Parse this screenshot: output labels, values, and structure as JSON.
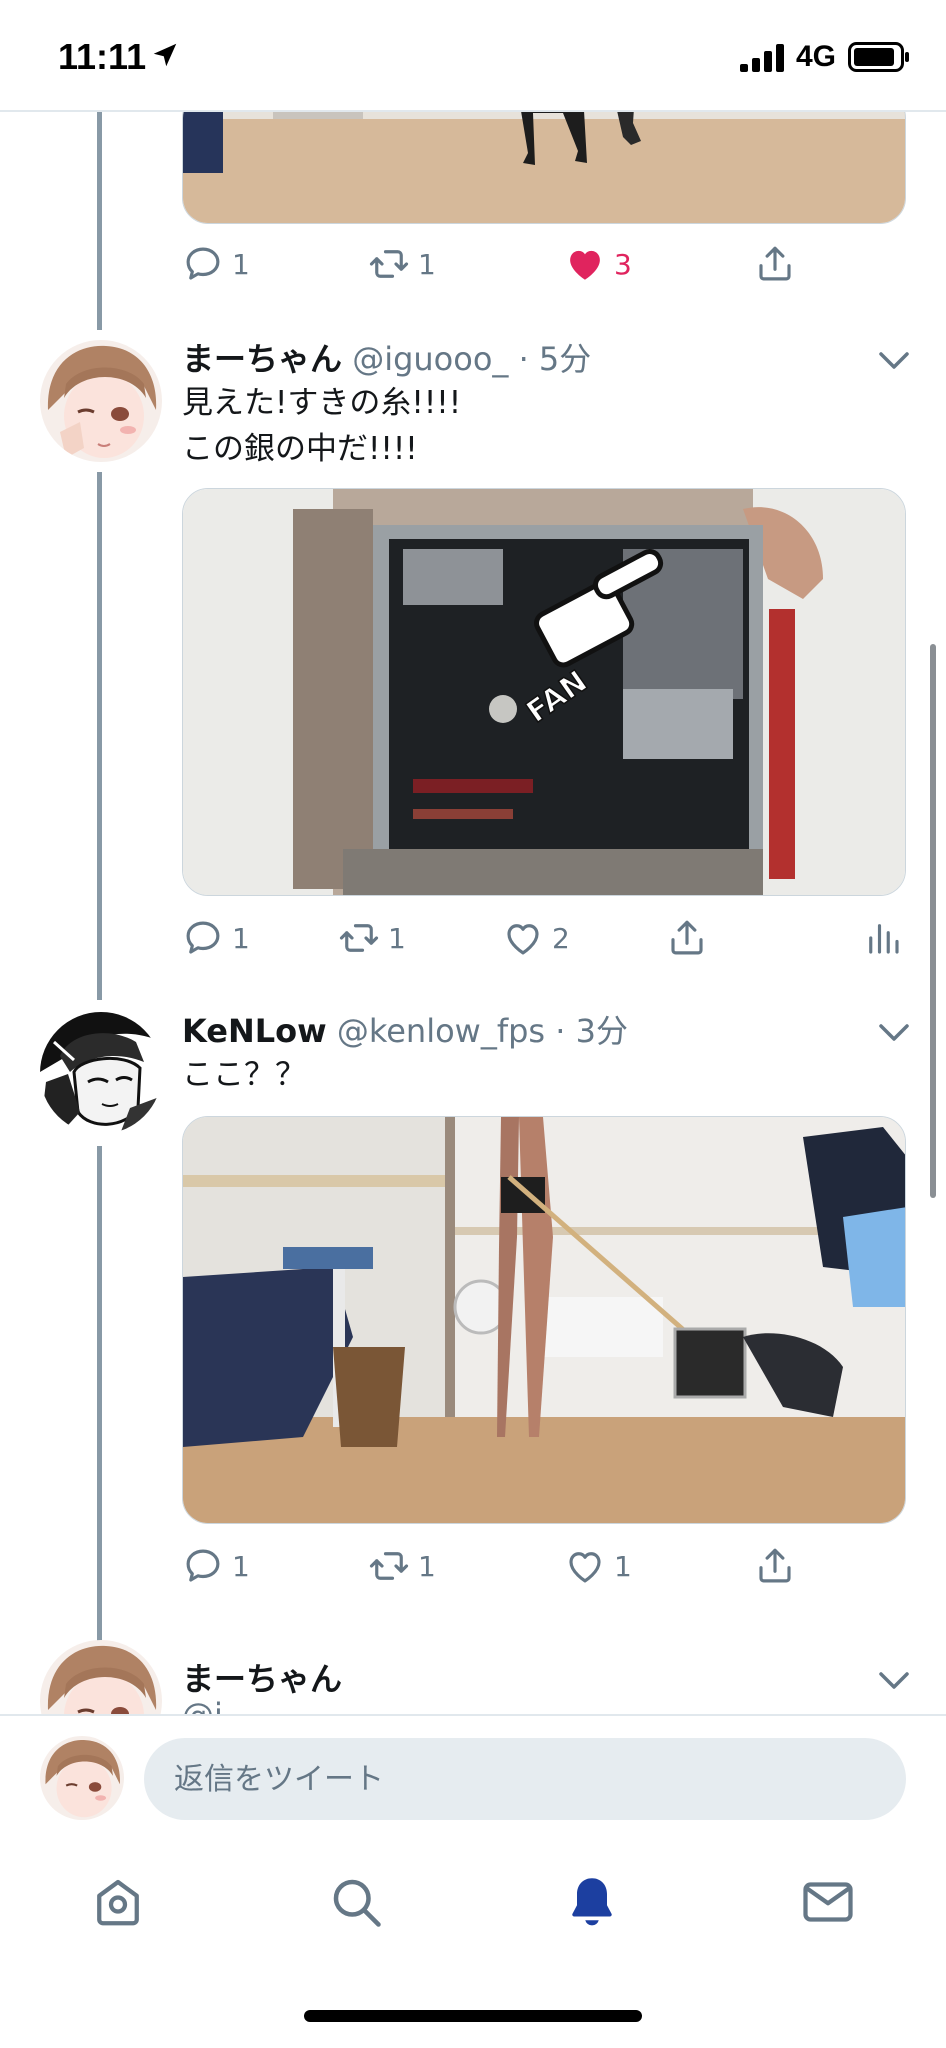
{
  "status": {
    "time": "11:11",
    "network": "4G"
  },
  "tweets": [
    {
      "actions": {
        "reply": "1",
        "retweet": "1",
        "like": "3",
        "liked": true
      }
    },
    {
      "name": "まーちゃん",
      "handle": "@iguooo_",
      "time": "5分",
      "text": "見えた!すきの糸!!!!\nこの銀の中だ!!!!",
      "media_overlay": "FAN",
      "actions": {
        "reply": "1",
        "retweet": "1",
        "like": "2",
        "liked": false
      }
    },
    {
      "name": "KeNLow",
      "handle": "@kenlow_fps",
      "time": "3分",
      "text": "ここ？？",
      "actions": {
        "reply": "1",
        "retweet": "1",
        "like": "1",
        "liked": false
      }
    },
    {
      "name": "まーちゃん",
      "handle": "@i"
    }
  ],
  "reply": {
    "placeholder": "返信をツイート"
  },
  "tabs": [
    {
      "icon": "home-icon"
    },
    {
      "icon": "search-icon"
    },
    {
      "icon": "notifications-bell-icon",
      "active": true
    },
    {
      "icon": "messages-envelope-icon"
    }
  ],
  "colors": {
    "like_red": "#e0245e",
    "accent_blue": "#1da1f2",
    "active_tab": "#1c3fa0",
    "meta_gray": "#657786"
  }
}
